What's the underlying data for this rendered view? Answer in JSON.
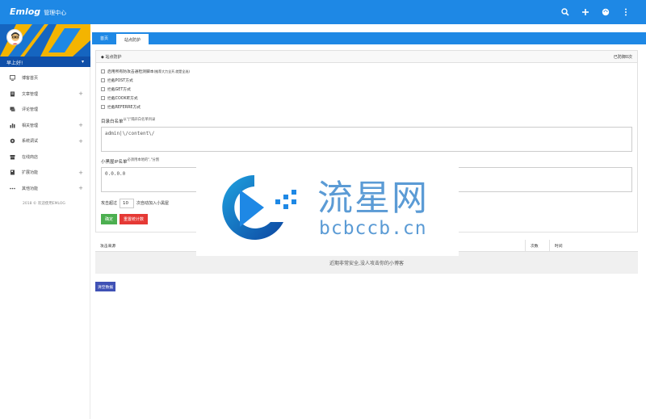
{
  "header": {
    "logo": "Emlog",
    "title": "管理中心",
    "icons": [
      "search-icon",
      "plus-icon",
      "palette-icon",
      "more-vert-icon"
    ]
  },
  "sidebar": {
    "greeting": "早上好!",
    "items": [
      {
        "label": "博客首页",
        "icon": "monitor-icon",
        "expandable": false
      },
      {
        "label": "文章管理",
        "icon": "document-icon",
        "expandable": true
      },
      {
        "label": "评论管理",
        "icon": "comment-icon",
        "expandable": false
      },
      {
        "label": "相关管理",
        "icon": "chart-icon",
        "expandable": true
      },
      {
        "label": "系统调试",
        "icon": "gear-icon",
        "expandable": true
      },
      {
        "label": "在线商店",
        "icon": "store-icon",
        "expandable": false
      },
      {
        "label": "扩展功能",
        "icon": "puzzle-icon",
        "expandable": true
      },
      {
        "label": "其他功能",
        "icon": "dots-icon",
        "expandable": true
      }
    ],
    "copyright": "2018 © 欢迎使用EMLOG"
  },
  "tabs": [
    {
      "label": "首页",
      "active": false
    },
    {
      "label": "站点防护",
      "active": true
    }
  ],
  "panel": {
    "title": "站点防护",
    "count_text": "已防御0次",
    "checkboxes": [
      {
        "label": "启用所有防攻击通检测脚本",
        "note": "(推荐大力全开,就是全选)"
      },
      {
        "label": "拦截POST方式",
        "note": ""
      },
      {
        "label": "拦截GET方式",
        "note": ""
      },
      {
        "label": "拦截COOKIE方式",
        "note": ""
      },
      {
        "label": "拦截REFERRE方式",
        "note": ""
      }
    ],
    "whitelist_label": "目录白名单",
    "whitelist_note": "以\"|\"隔开白名单目录",
    "whitelist_value": "admin|\\/content\\/",
    "blacklist_label": "小黑屋IP名单",
    "blacklist_note": "必须用本地的\",\"分割",
    "blacklist_value": "0.0.0.0",
    "attack_prefix": "攻击超过",
    "attack_value": "10",
    "attack_suffix": "次自动加入小黑屋",
    "confirm_label": "确定",
    "reset_label": "重置统计数"
  },
  "table": {
    "col_source": "攻击来源",
    "col_count": "次数",
    "col_time": "时间",
    "empty_message": "近期非常安全,没人攻击你的小博客"
  },
  "clear_label": "清空数据",
  "watermark": {
    "text": "流星网",
    "url": "bcbccb.cn"
  }
}
